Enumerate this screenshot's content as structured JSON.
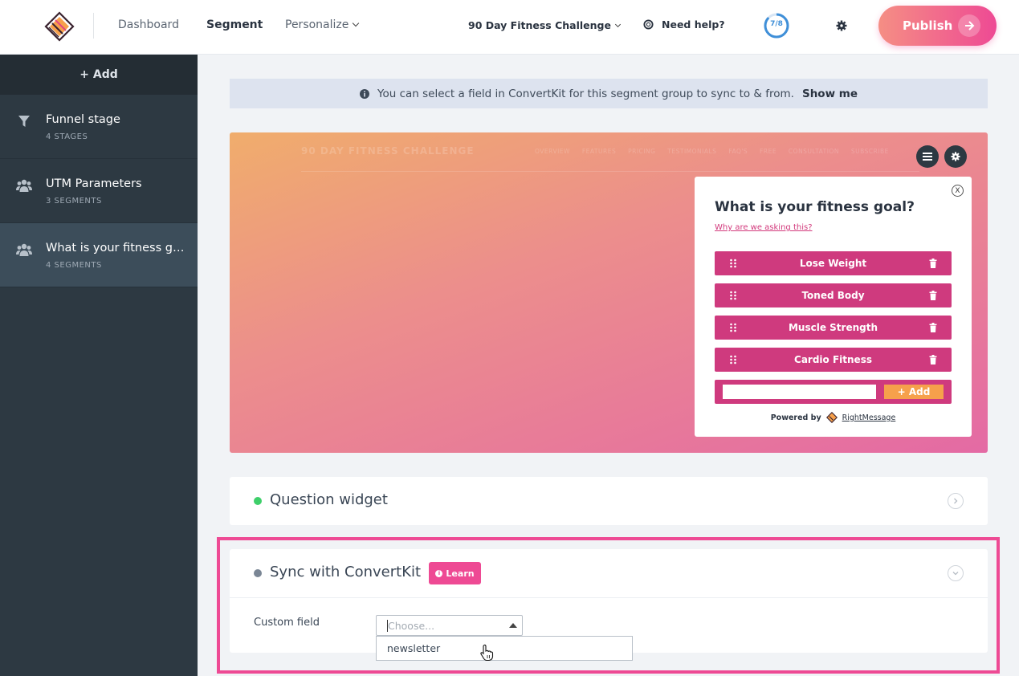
{
  "nav": {
    "dashboard": "Dashboard",
    "segment": "Segment",
    "personalize": "Personalize",
    "project": "90 Day Fitness Challenge",
    "help": "Need help?",
    "progress": "7/8",
    "progress_fraction": 0.875,
    "publish": "Publish"
  },
  "sidebar": {
    "add": "+ Add",
    "items": [
      {
        "title": "Funnel stage",
        "sub": "4 STAGES",
        "icon": "filter-icon"
      },
      {
        "title": "UTM Parameters",
        "sub": "3 SEGMENTS",
        "icon": "users-icon"
      },
      {
        "title": "What is your fitness go...",
        "sub": "4 SEGMENTS",
        "icon": "users-icon"
      }
    ]
  },
  "info": {
    "text": "You can select a field in ConvertKit for this segment group to sync to & from.",
    "link": "Show me"
  },
  "preview": {
    "site_title": "90 DAY FITNESS CHALLENGE",
    "site_nav": "OVERVIEW FEATURES PRICING TESTIMONIALS FAQ'S FREE CONSULTATION SUBSCRIBE"
  },
  "widget": {
    "close": "X",
    "title": "What is your fitness goal?",
    "link": "Why are we asking this?",
    "options": [
      "Lose Weight",
      "Toned Body",
      "Muscle Strength",
      "Cardio Fitness"
    ],
    "add": "+ Add",
    "powered_by": "Powered by",
    "brand": "RightMessage"
  },
  "panels": {
    "question": "Question widget",
    "sync": "Sync with ConvertKit",
    "learn": "Learn",
    "custom_field_label": "Custom field",
    "custom_field_placeholder": "Choose...",
    "dropdown_option": "newsletter"
  },
  "colors": {
    "accent": "#ee4a94",
    "sidebar": "#2d3942",
    "status_green": "#3ecf6a"
  }
}
